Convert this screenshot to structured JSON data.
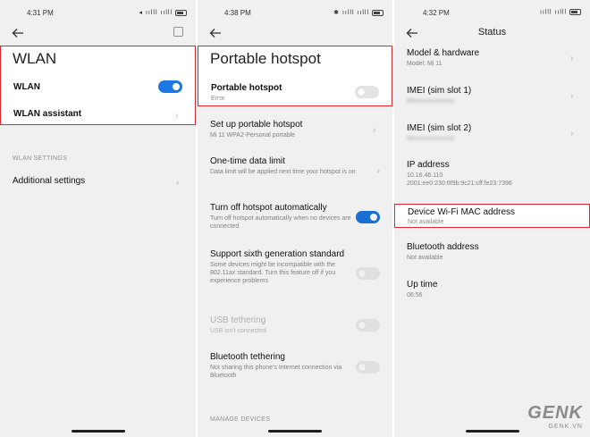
{
  "panel1": {
    "status_time": "4:31 PM",
    "status_icons": "◂ ıılll ıılll",
    "title": "WLAN",
    "wlan_label": "WLAN",
    "wlan_toggle": "on",
    "wlan_assistant_label": "WLAN assistant",
    "section_label": "WLAN SETTINGS",
    "additional_settings_label": "Additional settings"
  },
  "panel2": {
    "status_time": "4:38 PM",
    "status_icons": "✱ ıılll ıılll",
    "title": "Portable hotspot",
    "hotspot_label": "Portable hotspot",
    "hotspot_sub": "Error",
    "setup_label": "Set up portable hotspot",
    "setup_sub": "Mi 11 WPA2-Personal portable",
    "limit_label": "One-time data limit",
    "limit_sub": "Data limit will be applied next time your hotspot is on",
    "auto_off_label": "Turn off hotspot automatically",
    "auto_off_sub": "Turn off hotspot automatically when no devices are connected",
    "sixth_gen_label": "Support sixth generation standard",
    "sixth_gen_sub": "Some devices might be incompatible with the 802.11ax standard. Turn this feature off if you experience problems",
    "usb_label": "USB tethering",
    "usb_sub": "USB isn't connected",
    "bt_label": "Bluetooth tethering",
    "bt_sub": "Not sharing this phone's Internet connection via Bluetooth",
    "section_label": "MANAGE DEVICES"
  },
  "panel3": {
    "status_time": "4:32 PM",
    "status_icons": "ıılll ıılll",
    "title": "Status",
    "model_label": "Model & hardware",
    "model_sub": "Model: Mi 11",
    "imei1_label": "IMEI (sim slot 1)",
    "imei1_sub": "86xxxxxxxxxxxxx",
    "imei2_label": "IMEI (sim slot 2)",
    "imei2_sub": "86xxxxxxxxxxxxx",
    "ip_label": "IP address",
    "ip_sub1": "10.16.46.110",
    "ip_sub2": "2001:ee0:230:6f9b:9c21:cff:fe23:7396",
    "mac_label": "Device Wi-Fi MAC address",
    "mac_sub": "Not available",
    "bt_addr_label": "Bluetooth address",
    "bt_addr_sub": "Not available",
    "uptime_label": "Up time",
    "uptime_sub": "06:56"
  },
  "watermark": {
    "main": "GENK",
    "sub": "GENK.VN"
  },
  "colors": {
    "accent": "#1b78e0",
    "highlight_border": "#e0262e"
  }
}
